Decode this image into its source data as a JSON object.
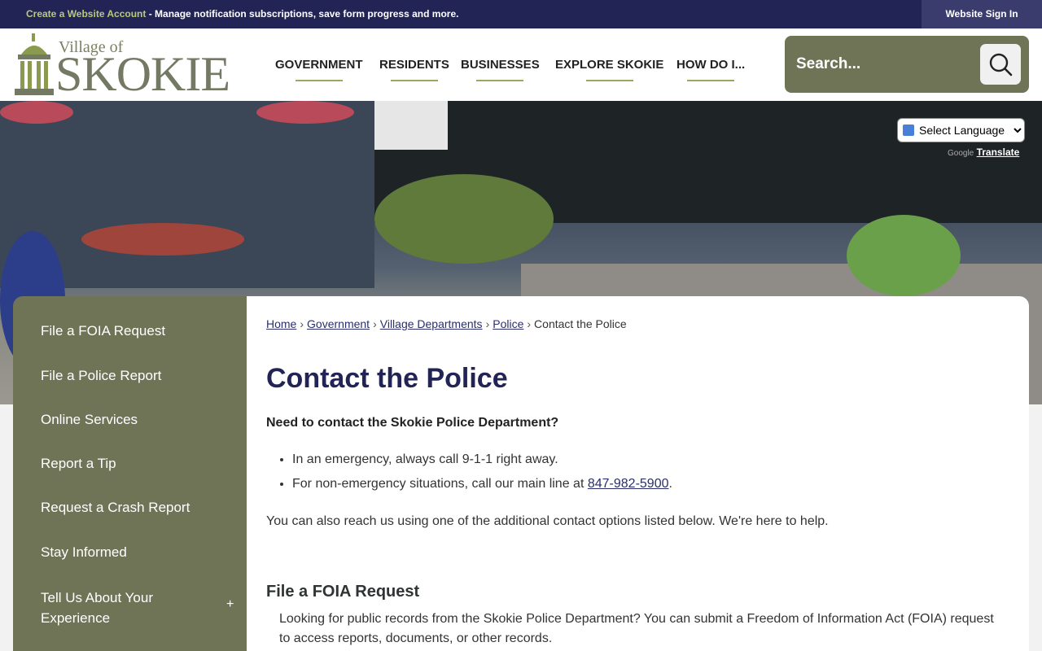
{
  "topbar": {
    "promo_highlight": "Create a Website Account",
    "promo_text": " - Manage notification subscriptions, save form progress and more.",
    "sign_in": "Website Sign In"
  },
  "logo": {
    "village": "Village of",
    "name": "SKOKIE"
  },
  "nav": {
    "items": [
      "GOVERNMENT",
      "RESIDENTS",
      "BUSINESSES",
      "EXPLORE SKOKIE",
      "HOW DO I..."
    ]
  },
  "search": {
    "placeholder": "Search..."
  },
  "translate": {
    "select_label": "Select Language",
    "powered": "Google",
    "link": "Translate"
  },
  "sidebar": {
    "items": [
      "File a FOIA Request",
      "File a Police Report",
      "Online Services",
      "Report a Tip",
      "Request a Crash Report",
      "Stay Informed",
      "Tell Us About Your Experience"
    ],
    "expand_symbol": "+"
  },
  "breadcrumb": {
    "links": [
      "Home",
      "Government",
      "Village Departments",
      "Police"
    ],
    "current": "Contact the Police",
    "separator": "›"
  },
  "content": {
    "title": "Contact the Police",
    "lead": "Need to contact the Skokie Police Department?",
    "bullet1": "In an emergency, always call 9-1-1 right away.",
    "bullet2_prefix": "For non-emergency situations, call our main line at ",
    "bullet2_phone": "847-982-5900",
    "bullet2_suffix": ".",
    "para": "You can also reach us using one of the additional contact options listed below. We're here to help.",
    "section_title": "File a FOIA Request",
    "section_body": "Looking for public records from the Skokie Police Department? You can submit a Freedom of Information Act (FOIA) request to access reports, documents, or other records."
  },
  "colors": {
    "navy": "#232456",
    "olive": "#6f7457",
    "accent_green": "#9aa75c"
  }
}
